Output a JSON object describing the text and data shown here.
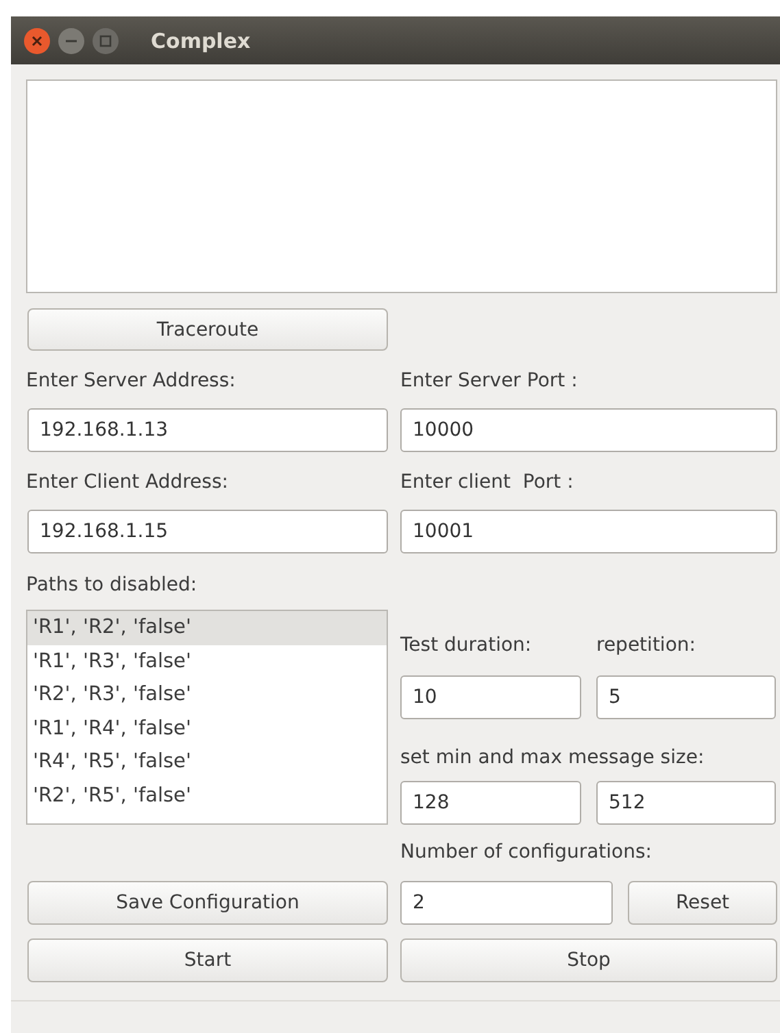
{
  "window": {
    "title": "Complex"
  },
  "traceroute_button": "Traceroute",
  "server_address": {
    "label": "Enter Server Address:",
    "value": "192.168.1.13"
  },
  "server_port": {
    "label": "Enter Server Port :",
    "value": "10000"
  },
  "client_address": {
    "label": "Enter Client Address:",
    "value": "192.168.1.15"
  },
  "client_port": {
    "label": "Enter client  Port :",
    "value": "10001"
  },
  "paths": {
    "label": "Paths to disabled:",
    "items": [
      {
        "text": "'R1', 'R2', 'false'",
        "selected": true
      },
      {
        "text": "'R1', 'R3', 'false'",
        "selected": false
      },
      {
        "text": "'R2', 'R3', 'false'",
        "selected": false
      },
      {
        "text": "'R1', 'R4', 'false'",
        "selected": false
      },
      {
        "text": "'R4', 'R5', 'false'",
        "selected": false
      },
      {
        "text": "'R2', 'R5', 'false'",
        "selected": false
      }
    ]
  },
  "test_duration": {
    "label": "Test duration:",
    "value": "10"
  },
  "repetition": {
    "label": "repetition:",
    "value": "5"
  },
  "message_size": {
    "label": "set min and max message size:",
    "min": "128",
    "max": "512"
  },
  "configurations": {
    "label": "Number of configurations:",
    "value": "2"
  },
  "save_button": "Save Configuration",
  "reset_button": "Reset",
  "start_button": "Start",
  "stop_button": "Stop"
}
